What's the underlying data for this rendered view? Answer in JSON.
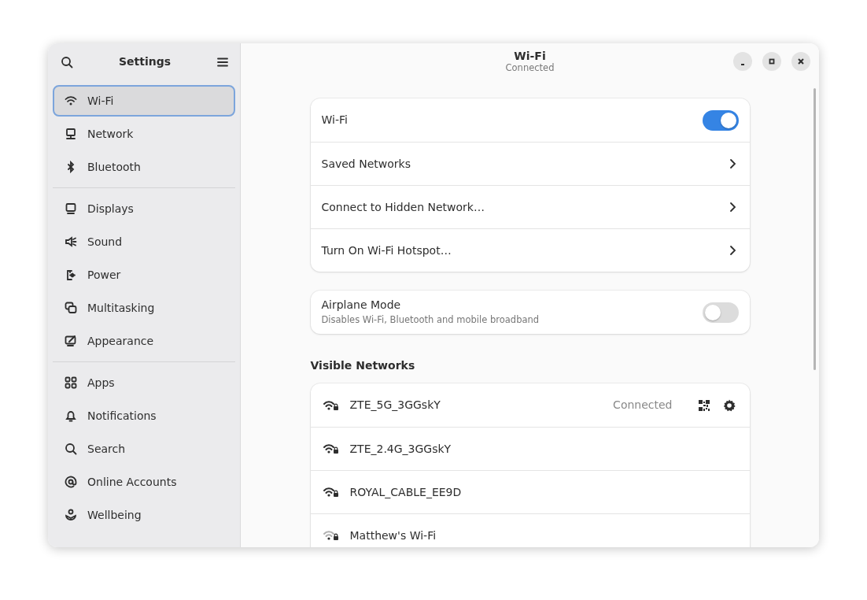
{
  "sidebar": {
    "title": "Settings",
    "groups": [
      [
        {
          "label": "Wi-Fi",
          "selected": true
        },
        {
          "label": "Network",
          "selected": false
        },
        {
          "label": "Bluetooth",
          "selected": false
        }
      ],
      [
        {
          "label": "Displays",
          "selected": false
        },
        {
          "label": "Sound",
          "selected": false
        },
        {
          "label": "Power",
          "selected": false
        },
        {
          "label": "Multitasking",
          "selected": false
        },
        {
          "label": "Appearance",
          "selected": false
        }
      ],
      [
        {
          "label": "Apps",
          "selected": false
        },
        {
          "label": "Notifications",
          "selected": false
        },
        {
          "label": "Search",
          "selected": false
        },
        {
          "label": "Online Accounts",
          "selected": false
        },
        {
          "label": "Wellbeing",
          "selected": false
        }
      ]
    ]
  },
  "header": {
    "title": "Wi-Fi",
    "subtitle": "Connected"
  },
  "wifi_card": [
    {
      "kind": "switch",
      "label": "Wi-Fi",
      "on": true
    },
    {
      "kind": "link",
      "label": "Saved Networks"
    },
    {
      "kind": "link",
      "label": "Connect to Hidden Network…"
    },
    {
      "kind": "link",
      "label": "Turn On Wi-Fi Hotspot…"
    }
  ],
  "airplane": {
    "label": "Airplane Mode",
    "description": "Disables Wi-Fi, Bluetooth and mobile broadband",
    "on": false
  },
  "visible_networks": {
    "heading": "Visible Networks",
    "networks": [
      {
        "name": "ZTE_5G_3GGskY",
        "weak_signal": false,
        "secured": true,
        "connected": true,
        "status": "Connected"
      },
      {
        "name": "ZTE_2.4G_3GGskY",
        "weak_signal": false,
        "secured": true,
        "connected": false
      },
      {
        "name": "ROYAL_CABLE_EE9D",
        "weak_signal": false,
        "secured": true,
        "connected": false
      },
      {
        "name": "Matthew's Wi-Fi",
        "weak_signal": true,
        "secured": true,
        "connected": false
      }
    ]
  }
}
